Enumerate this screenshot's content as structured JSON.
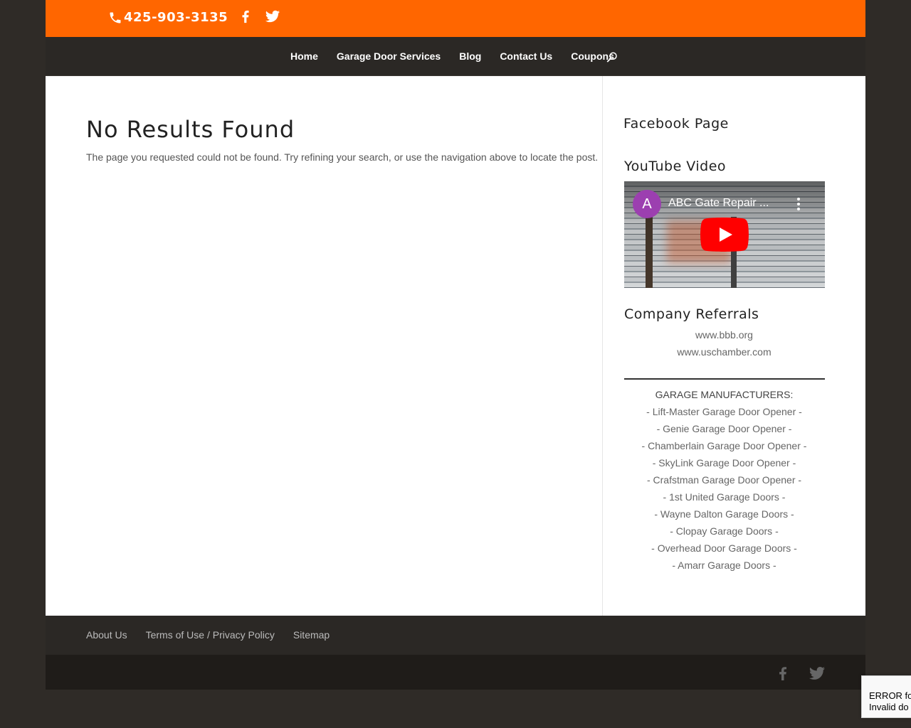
{
  "topbar": {
    "phone": "425-903-3135",
    "social": [
      "facebook-icon",
      "twitter-icon"
    ],
    "accent": "#ff6600"
  },
  "nav": {
    "items": [
      "Home",
      "Garage Door Services",
      "Blog",
      "Contact Us",
      "Coupons"
    ]
  },
  "main": {
    "title": "No Results Found",
    "message": "The page you requested could not be found. Try refining your search, or use the navigation above to locate the post."
  },
  "sidebar": {
    "facebook_heading": "Facebook Page",
    "youtube_heading": "YouTube Video",
    "video": {
      "avatar_letter": "A",
      "title": "ABC Gate Repair ..."
    },
    "referrals_heading": "Company Referrals",
    "referrals": [
      "www.bbb.org",
      "www.uschamber.com"
    ],
    "manufacturers_title": "GARAGE MANUFACTURERS:",
    "manufacturers": [
      "- Lift-Master Garage Door Opener -",
      "- Genie Garage Door Opener -",
      "- Chamberlain Garage Door Opener -",
      "- SkyLink Garage Door Opener -",
      "- Crafstman Garage Door Opener -",
      "- 1st United Garage Doors -",
      "- Wayne Dalton Garage Doors -",
      "- Clopay Garage Doors -",
      "- Overhead Door Garage Doors -",
      "- Amarr Garage Doors -"
    ]
  },
  "footer": {
    "links": [
      "About Us",
      "Terms of Use / Privacy Policy",
      "Sitemap"
    ],
    "social": [
      "facebook-icon",
      "twitter-icon"
    ]
  },
  "recaptcha": {
    "line1": "ERROR fo",
    "line2": "Invalid do"
  }
}
